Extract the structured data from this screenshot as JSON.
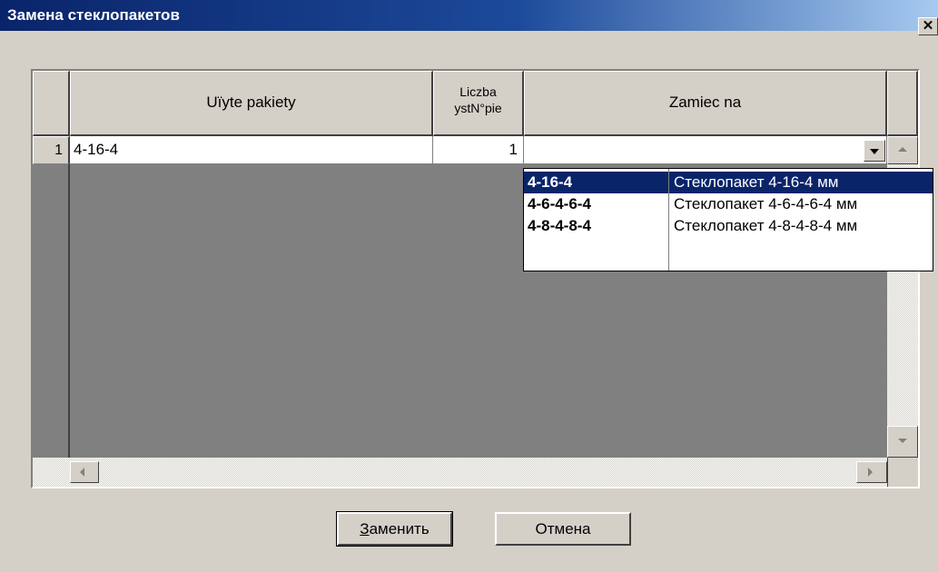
{
  "window": {
    "title": "Замена стеклопакетов",
    "close_glyph": "✕"
  },
  "grid": {
    "columns": [
      {
        "label": "Uïyte pakiety"
      },
      {
        "label_line1": "Liczba",
        "label_line2": "ystN°pie"
      },
      {
        "label": "Zamiec na"
      }
    ],
    "rows": [
      {
        "num": "1",
        "used": "4-16-4",
        "count": "1",
        "replace": ""
      }
    ]
  },
  "dropdown": {
    "options": [
      {
        "code": "4-16-4",
        "desc": "Стеклопакет 4-16-4 мм",
        "selected": true
      },
      {
        "code": "4-6-4-6-4",
        "desc": "Стеклопакет 4-6-4-6-4 мм",
        "selected": false
      },
      {
        "code": "4-8-4-8-4",
        "desc": "Стеклопакет 4-8-4-8-4 мм",
        "selected": false
      }
    ]
  },
  "buttons": {
    "replace": "Заменить",
    "cancel": "Отмена"
  },
  "colors": {
    "selection": "#0a246a",
    "face": "#d4d0c8",
    "title_start": "#0a246a",
    "title_end": "#a6caf0"
  }
}
